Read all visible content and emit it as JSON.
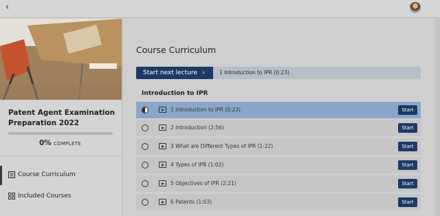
{
  "topbar": {
    "back_icon": "back-chevron-icon",
    "avatar": "user-avatar"
  },
  "sidebar": {
    "course_title": "Patent Agent Examination Preparation 2022",
    "progress_percent": "0%",
    "progress_value": 0,
    "progress_label": "COMPLETE",
    "nav": [
      {
        "label": "Course Curriculum",
        "icon": "list-icon",
        "active": true
      },
      {
        "label": "Included Courses",
        "icon": "grid-icon",
        "active": false
      }
    ]
  },
  "main": {
    "title": "Course Curriculum",
    "next_button_label": "Start next lecture",
    "next_lecture_text": "1 Introduction to IPR (0:23)",
    "section_title": "Introduction to IPR",
    "lectures": [
      {
        "title": "1 Introduction to IPR (0:23)",
        "button": "Start",
        "current": true
      },
      {
        "title": "2 Introduction (2:56)",
        "button": "Start",
        "current": false
      },
      {
        "title": "3 What are Different Types of IPR (1:22)",
        "button": "Start",
        "current": false
      },
      {
        "title": "4 Types of IPR (1:02)",
        "button": "Start",
        "current": false
      },
      {
        "title": "5 Objectives of IPR (2:21)",
        "button": "Start",
        "current": false
      },
      {
        "title": "6 Patents (1:03)",
        "button": "Start",
        "current": false
      }
    ]
  },
  "colors": {
    "primary": "#1d3a66",
    "current_row": "#8aa6c9",
    "overlay_gray": "#cfcfcf"
  }
}
